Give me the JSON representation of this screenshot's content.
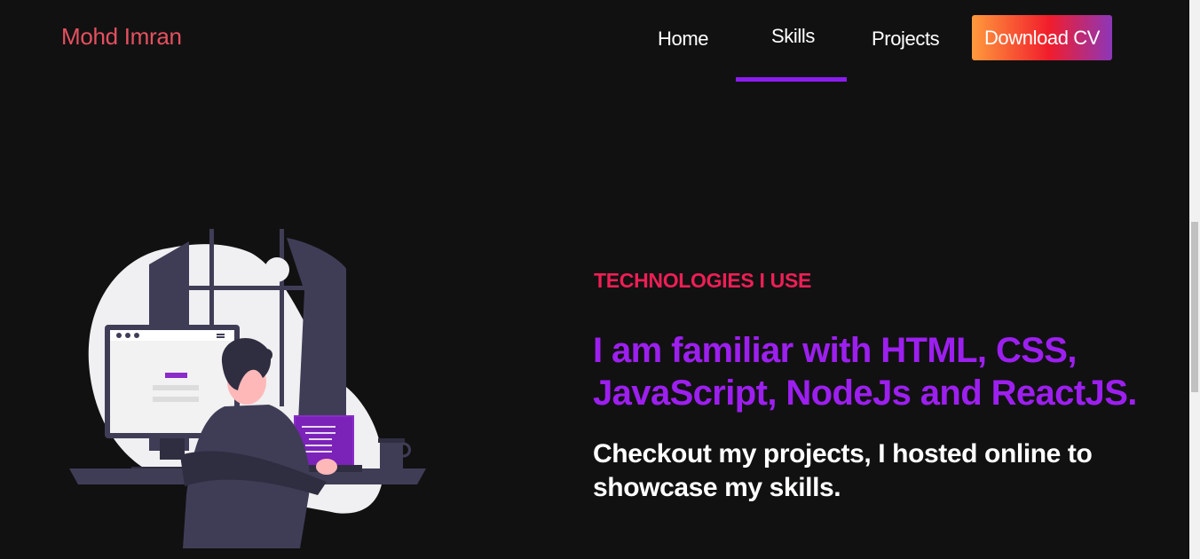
{
  "brand": {
    "name": "Mohd Imran"
  },
  "nav": {
    "items": [
      {
        "label": "Home"
      },
      {
        "label": "Skills",
        "active": true
      },
      {
        "label": "Projects"
      }
    ],
    "cv_label": "Download CV"
  },
  "hero": {
    "eyebrow": "TECHNOLOGIES I USE",
    "headline": "I am familiar with HTML, CSS, JavaScript, NodeJs and ReactJS.",
    "subtext": "Checkout my projects, I hosted online to showcase my skills."
  },
  "colors": {
    "background": "#121112",
    "brand": "#e4515f",
    "accent": "#8a1cf0",
    "eyebrow": "#ee1f55",
    "headline": "#9d1ff0"
  },
  "icons": {
    "illustration": "developer-at-desk-illustration"
  }
}
